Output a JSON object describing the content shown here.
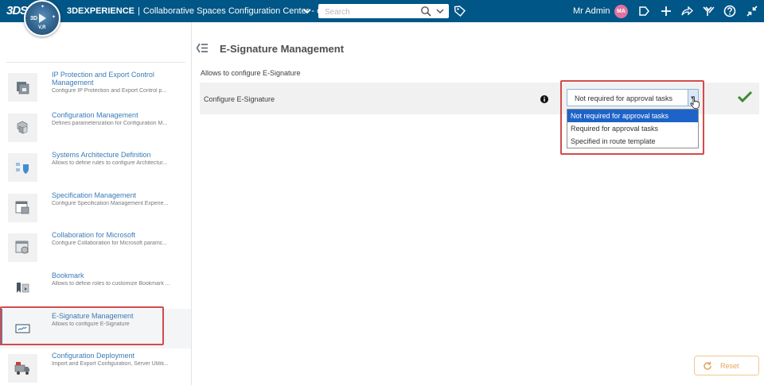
{
  "topbar": {
    "brand_bold": "3DEXPERIENCE",
    "brand_separator": "|",
    "app_title": "Collaborative Spaces Configuration Center - o...",
    "search_placeholder": "Search",
    "user_name": "Mr Admin",
    "avatar_initials": "MA",
    "compass_3d": "3D",
    "compass_vr": "V,R",
    "logo": "3DS",
    "bar_color": "#005686"
  },
  "sidebar": {
    "items": [
      {
        "title": "IP Protection and Export Control Management",
        "description": "Configure IP Protection and Export Control p...",
        "icon": "ip-protection-icon"
      },
      {
        "title": "Configuration Management",
        "description": "Defines parameterization for Configuration M...",
        "icon": "configuration-cubes-icon"
      },
      {
        "title": "Systems Architecture Definition",
        "description": "Allows to define rules to configure Architectur...",
        "icon": "systems-architecture-icon"
      },
      {
        "title": "Specification Management",
        "description": "Configure Specification Management Experie...",
        "icon": "specification-icon"
      },
      {
        "title": "Collaboration for Microsoft",
        "description": "Configure Collaboration for Microsoft paramc...",
        "icon": "microsoft-collab-icon"
      },
      {
        "title": "Bookmark",
        "description": "Allows to define roles to customize Bookmark ...",
        "icon": "bookmark-icon"
      },
      {
        "title": "E-Signature Management",
        "description": "Allows to configure E-Signature",
        "icon": "esignature-icon",
        "selected": true
      },
      {
        "title": "Configuration Deployment",
        "description": "Import and Export Configuration, Server Utiliti...",
        "icon": "deployment-truck-icon"
      }
    ]
  },
  "main": {
    "title": "E-Signature Management",
    "subtitle": "Allows to configure E-Signature",
    "setting": {
      "label": "Configure E-Signature",
      "selected_value": "Not required for approval tasks",
      "options": [
        "Not required for approval tasks",
        "Required for approval tasks",
        "Specified in route template"
      ]
    },
    "reset_label": "Reset"
  },
  "colors": {
    "accent_blue": "#368ec4",
    "link_blue": "#3a7ab7",
    "highlight_red": "#d24b4b",
    "check_green": "#3a8a2f",
    "reset_orange": "#e8a35a",
    "option_active": "#1e64c8"
  }
}
